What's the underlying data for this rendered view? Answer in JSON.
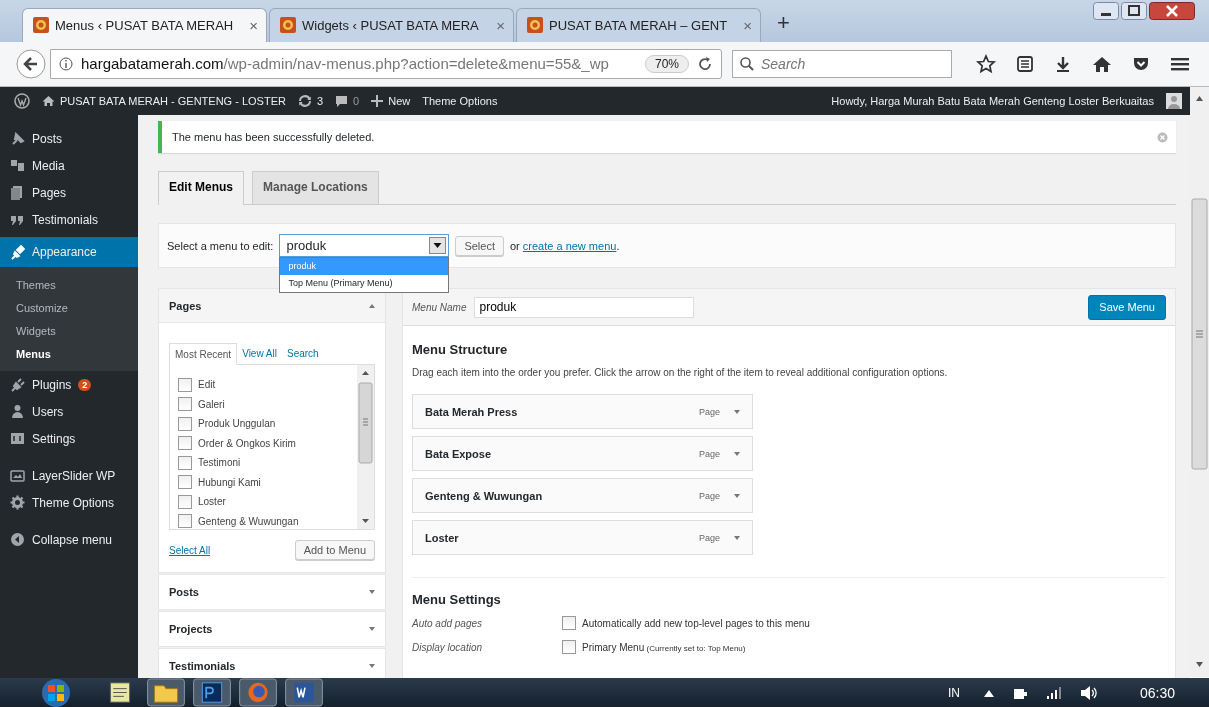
{
  "browser": {
    "tabs": [
      {
        "title": "Menus ‹ PUSAT BATA MERAH",
        "selected": true
      },
      {
        "title": "Widgets ‹ PUSAT BATA MERA",
        "selected": false
      },
      {
        "title": "PUSAT BATA MERAH – GENT",
        "selected": false
      }
    ],
    "close_mark": "×",
    "new_tab": "+",
    "url_host": "hargabatamerah.com",
    "url_path": "/wp-admin/nav-menus.php?action=delete&menu=55&_wp",
    "zoom": "70%",
    "search": {
      "placeholder": "Search"
    }
  },
  "admin_bar": {
    "site": "PUSAT BATA MERAH - GENTENG - LOSTER",
    "updates": "3",
    "comments": "0",
    "new": "New",
    "theme_options": "Theme Options",
    "howdy": "Howdy, Harga Murah Batu Bata Merah Genteng Loster Berkuaitas"
  },
  "sidebar": {
    "items": [
      {
        "label": "Posts",
        "selected": false
      },
      {
        "label": "Media",
        "selected": false
      },
      {
        "label": "Pages",
        "selected": false
      },
      {
        "label": "Testimonials",
        "selected": false
      },
      {
        "label": "Appearance",
        "selected": true,
        "children": [
          {
            "label": "Themes",
            "selected": false
          },
          {
            "label": "Customize",
            "selected": false
          },
          {
            "label": "Widgets",
            "selected": false
          },
          {
            "label": "Menus",
            "selected": true
          }
        ]
      },
      {
        "label": "Plugins",
        "selected": false,
        "badge": "2"
      },
      {
        "label": "Users",
        "selected": false
      },
      {
        "label": "Settings",
        "selected": false
      },
      {
        "label": "LayerSlider WP",
        "selected": false
      },
      {
        "label": "Theme Options",
        "selected": false
      },
      {
        "label": "Collapse menu",
        "selected": false
      }
    ]
  },
  "notice": "The menu has been successfully deleted.",
  "tabs": [
    {
      "label": "Edit Menus",
      "selected": true
    },
    {
      "label": "Manage Locations",
      "selected": false
    }
  ],
  "menu_select": {
    "label": "Select a menu to edit:",
    "value": "produk",
    "button": "Select",
    "prefix": "or ",
    "link": "create a new menu",
    "suffix": ".",
    "options": [
      {
        "label": "produk",
        "selected": true
      },
      {
        "label": "Top Menu (Primary Menu)",
        "selected": false
      }
    ]
  },
  "add_panels": [
    {
      "title": "Pages",
      "expanded": true,
      "tabs": [
        {
          "label": "Most Recent",
          "selected": true
        },
        {
          "label": "View All",
          "selected": false
        },
        {
          "label": "Search",
          "selected": false
        }
      ],
      "items": [
        {
          "label": "Edit",
          "checked": false
        },
        {
          "label": "Galeri",
          "checked": false
        },
        {
          "label": "Produk Unggulan",
          "checked": false
        },
        {
          "label": "Order & Ongkos Kirim",
          "checked": false
        },
        {
          "label": "Testimoni",
          "checked": false
        },
        {
          "label": "Hubungi Kami",
          "checked": false
        },
        {
          "label": "Loster",
          "checked": false
        },
        {
          "label": "Genteng & Wuwungan",
          "checked": false
        }
      ],
      "select_all": "Select All",
      "add_button": "Add to Menu"
    },
    {
      "title": "Posts",
      "expanded": false
    },
    {
      "title": "Projects",
      "expanded": false
    },
    {
      "title": "Testimonials",
      "expanded": false
    }
  ],
  "menu_editor": {
    "name_label": "Menu Name",
    "name_value": "produk",
    "save": "Save Menu",
    "structure_title": "Menu Structure",
    "structure_help": "Drag each item into the order you prefer. Click the arrow on the right of the item to reveal additional configuration options.",
    "items": [
      {
        "title": "Bata Merah Press",
        "type": "Page"
      },
      {
        "title": "Bata Expose",
        "type": "Page"
      },
      {
        "title": "Genteng & Wuwungan",
        "type": "Page"
      },
      {
        "title": "Loster",
        "type": "Page"
      }
    ],
    "settings_title": "Menu Settings",
    "settings": [
      {
        "label": "Auto add pages",
        "checked": false,
        "text": "Automatically add new top-level pages to this menu"
      },
      {
        "label": "Display location",
        "checked": false,
        "text": "Primary Menu",
        "note": "(Currently set to: Top Menu)"
      }
    ]
  },
  "taskbar": {
    "language": "IN",
    "clock": "06:30"
  }
}
